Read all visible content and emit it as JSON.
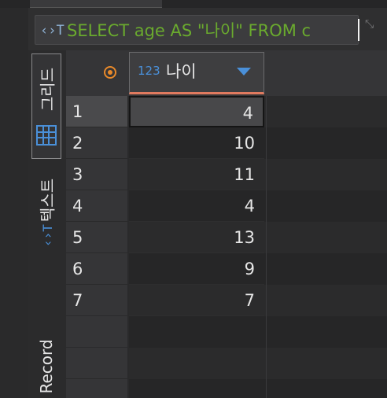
{
  "filter": {
    "query": "SELECT age AS \"나이\" FROM c",
    "icon": "sql-filter-icon"
  },
  "side_tabs": {
    "grid_label": "그리드",
    "text_label": "텍스트",
    "record_label": "Record"
  },
  "column": {
    "type_badge": "123",
    "name": "나이"
  },
  "rows": [
    {
      "num": "1",
      "value": "4"
    },
    {
      "num": "2",
      "value": "10"
    },
    {
      "num": "3",
      "value": "11"
    },
    {
      "num": "4",
      "value": "4"
    },
    {
      "num": "5",
      "value": "13"
    },
    {
      "num": "6",
      "value": "9"
    },
    {
      "num": "7",
      "value": "7"
    }
  ],
  "colors": {
    "accent_blue": "#4a90d9",
    "query_green": "#6aaa2e",
    "header_underline": "#e07a5f",
    "orange_icon": "#e8892a"
  }
}
